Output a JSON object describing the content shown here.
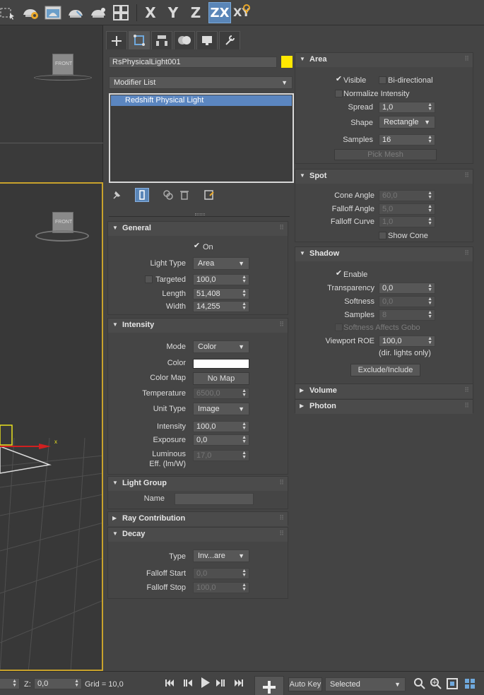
{
  "toolbar": {
    "axis_x": "X",
    "axis_y": "Y",
    "axis_z": "Z",
    "axis_zx": "ZX",
    "axis_xy": "XY"
  },
  "viewport": {
    "top_cube_label": "FRONT",
    "main_cube_label": "FRONT",
    "gizmo_x_label": "x"
  },
  "panel": {
    "object_name": "RsPhysicalLight001",
    "object_color": "#ffe800",
    "modifier_list_label": "Modifier List",
    "modifier_stack": [
      "Redshift Physical Light"
    ]
  },
  "general": {
    "title": "General",
    "on_label": "On",
    "light_type_label": "Light Type",
    "light_type_value": "Area",
    "targeted_label": "Targeted",
    "targeted_value": "100,0",
    "length_label": "Length",
    "length_value": "51,408",
    "width_label": "Width",
    "width_value": "14,255"
  },
  "intensity": {
    "title": "Intensity",
    "mode_label": "Mode",
    "mode_value": "Color",
    "color_label": "Color",
    "color_swatch": "#ffffff",
    "color_map_label": "Color Map",
    "color_map_button": "No Map",
    "temperature_label": "Temperature",
    "temperature_value": "6500,0",
    "unit_type_label": "Unit Type",
    "unit_type_value": "Image",
    "intensity_label": "Intensity",
    "intensity_value": "100,0",
    "exposure_label": "Exposure",
    "exposure_value": "0,0",
    "luminous_label_1": "Luminous",
    "luminous_label_2": "Eff. (lm/W)",
    "luminous_value": "17,0"
  },
  "light_group": {
    "title": "Light Group",
    "name_label": "Name",
    "name_value": ""
  },
  "ray_contribution": {
    "title": "Ray Contribution"
  },
  "decay": {
    "title": "Decay",
    "type_label": "Type",
    "type_value": "Inv...are",
    "falloff_start_label": "Falloff Start",
    "falloff_start_value": "0,0",
    "falloff_stop_label": "Falloff Stop",
    "falloff_stop_value": "100,0"
  },
  "area": {
    "title": "Area",
    "visible_label": "Visible",
    "bidirectional_label": "Bi-directional",
    "normalize_label": "Normalize Intensity",
    "spread_label": "Spread",
    "spread_value": "1,0",
    "shape_label": "Shape",
    "shape_value": "Rectangle",
    "samples_label": "Samples",
    "samples_value": "16",
    "pick_mesh_button": "Pick Mesh"
  },
  "spot": {
    "title": "Spot",
    "cone_angle_label": "Cone Angle",
    "cone_angle_value": "60,0",
    "falloff_angle_label": "Falloff Angle",
    "falloff_angle_value": "5,0",
    "falloff_curve_label": "Falloff Curve",
    "falloff_curve_value": "1,0",
    "show_cone_label": "Show Cone"
  },
  "shadow": {
    "title": "Shadow",
    "enable_label": "Enable",
    "transparency_label": "Transparency",
    "transparency_value": "0,0",
    "softness_label": "Softness",
    "softness_value": "0,0",
    "samples_label": "Samples",
    "samples_value": "8",
    "gobo_label": "Softness Affects Gobo",
    "viewport_roe_label": "Viewport ROE",
    "viewport_roe_value": "100,0",
    "dir_note": "(dir. lights only)",
    "exclude_button": "Exclude/Include"
  },
  "volume": {
    "title": "Volume"
  },
  "photon": {
    "title": "Photon"
  },
  "status": {
    "z_label": "Z:",
    "z_value": "0,0",
    "grid_label": "Grid = 10,0",
    "auto_key": "Auto Key",
    "selected_value": "Selected"
  }
}
